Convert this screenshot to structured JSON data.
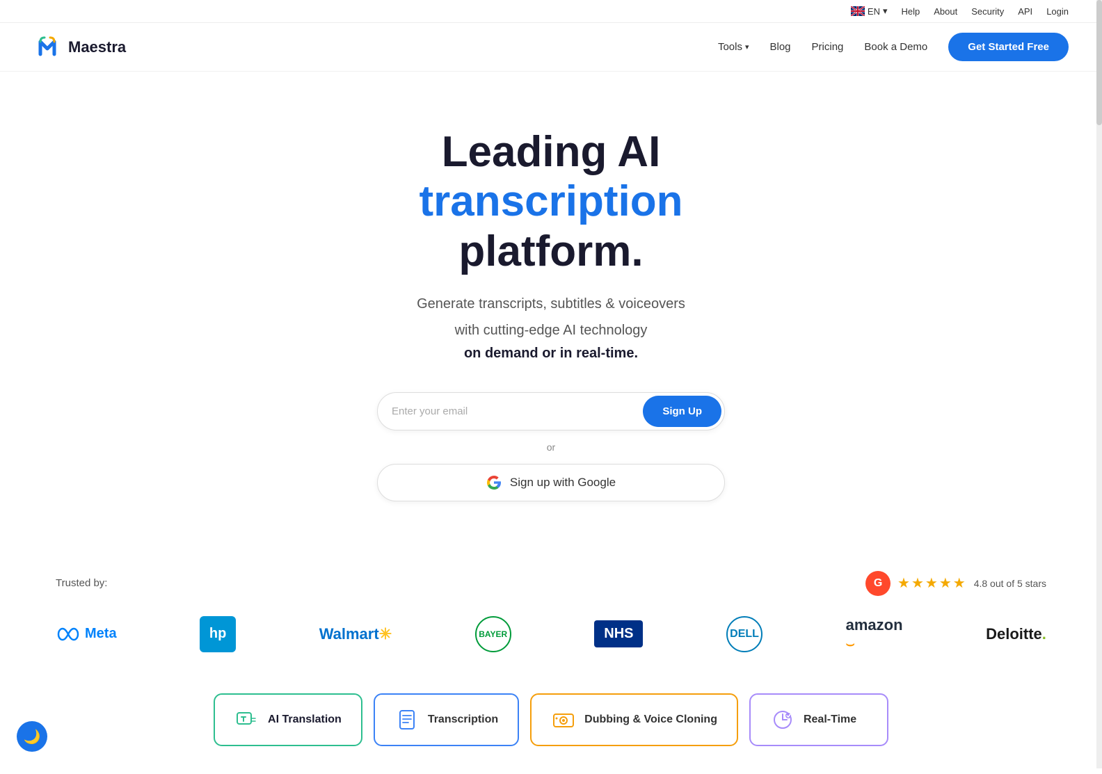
{
  "topbar": {
    "lang": "EN",
    "lang_chevron": "▾",
    "links": [
      "Help",
      "About",
      "Security",
      "API",
      "Login"
    ]
  },
  "navbar": {
    "logo_text": "Maestra",
    "links": [
      {
        "label": "Tools",
        "has_chevron": true
      },
      {
        "label": "Blog"
      },
      {
        "label": "Pricing"
      },
      {
        "label": "Book a Demo"
      }
    ],
    "cta": "Get Started Free"
  },
  "hero": {
    "line1": "Leading AI",
    "line2": "transcription",
    "line3": "platform.",
    "subtitle1": "Generate transcripts, subtitles & voiceovers",
    "subtitle2": "with cutting-edge AI technology",
    "subtitle3": "on demand or in real-time.",
    "email_placeholder": "Enter your email",
    "signup_btn": "Sign Up",
    "or_text": "or",
    "google_btn": "Sign up with Google"
  },
  "trusted": {
    "label": "Trusted by:",
    "rating_score": "4.8 out of 5 stars",
    "g2_label": "G",
    "logos": [
      {
        "name": "Meta"
      },
      {
        "name": "HP"
      },
      {
        "name": "Walmart"
      },
      {
        "name": "Bayer"
      },
      {
        "name": "NHS"
      },
      {
        "name": "Dell"
      },
      {
        "name": "Amazon"
      },
      {
        "name": "Deloitte"
      }
    ]
  },
  "features": [
    {
      "label": "AI Translation",
      "active": true,
      "icon": "💬"
    },
    {
      "label": "Transcription",
      "active": false,
      "icon": "📄"
    },
    {
      "label": "Dubbing & Voice Cloning",
      "active": false,
      "icon": "🎬"
    },
    {
      "label": "Real-Time",
      "active": false,
      "icon": "⏱"
    }
  ]
}
